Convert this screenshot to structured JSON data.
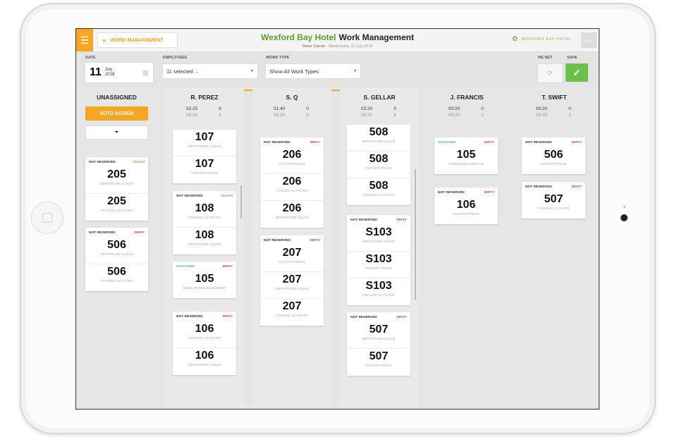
{
  "header": {
    "back_label": "WORK MANAGEMENT",
    "hotel": "Wexford Bay Hotel",
    "page": "Work Management",
    "user": "Steve Carran",
    "date_line": "Wednesday, 11 July 2018",
    "logo_text": "WEXFORD BAY HOTEL"
  },
  "toolbar": {
    "date_label": "DATE",
    "day": "11",
    "month": "July",
    "year": "2018",
    "employees_label": "EMPLOYEES",
    "employees_value": "11 selected ...",
    "worktype_label": "WORK TYPE",
    "worktype_value": "Show All Work Types",
    "reset_label": "RE-SET",
    "save_label": "SAVE"
  },
  "colors": {
    "accent": "#f5a623",
    "clean": "#6cc04a",
    "dirty": "#e0413c",
    "stayover": "#5aa7d8"
  },
  "columns": {
    "unassigned": {
      "title": "UNASSIGNED",
      "auto_assign": "AUTO ASSIGN",
      "cards": [
        {
          "status": "NOT RESERVED",
          "state": "CLEAN",
          "tasks": [
            {
              "room": "205",
              "type": "DEPARTURE CLEAN"
            },
            {
              "room": "205",
              "type": "CHANGE AC FILTER"
            }
          ]
        },
        {
          "status": "NOT RESERVED",
          "state": "DIRTY",
          "tasks": [
            {
              "room": "506",
              "type": "DEPARTURE CLEAN"
            },
            {
              "room": "506",
              "type": "CHANGE AC FILTER"
            }
          ]
        }
      ]
    },
    "perez": {
      "title": "R. PEREZ",
      "time_top": "02:25",
      "time_bot": "08:30",
      "count_top": "0",
      "count_bot": "8",
      "cards": [
        {
          "tasks": [
            {
              "room": "107",
              "type": "DEPARTURE CLEAN"
            },
            {
              "room": "107",
              "type": "FLIP MATTRESS"
            }
          ]
        },
        {
          "status": "NOT RESERVED",
          "state": "CLEAN",
          "tasks": [
            {
              "room": "108",
              "type": "CHANGE AC FILTER"
            },
            {
              "room": "108",
              "type": "DEPARTURE CLEAN"
            }
          ]
        },
        {
          "status": "STAYOVER",
          "state": "DIRTY",
          "tasks": [
            {
              "room": "105",
              "type": "MINIBAR REPLENISHMENT"
            }
          ]
        },
        {
          "status": "NOT RESERVED",
          "state": "DIRTY",
          "tasks": [
            {
              "room": "106",
              "type": "CHANGE AC FILTER"
            },
            {
              "room": "106",
              "type": "DEPARTURE CLEAN"
            }
          ]
        }
      ]
    },
    "sq": {
      "title": "S. Q",
      "time_top": "01:40",
      "time_bot": "08:30",
      "count_top": "0",
      "count_bot": "6",
      "cards": [
        {
          "status": "NOT RESERVED",
          "state": "DIRTY",
          "tasks": [
            {
              "room": "206",
              "type": "FLIP MATTRESS"
            },
            {
              "room": "206",
              "type": "CHANGE AC FILTER"
            },
            {
              "room": "206",
              "type": "DEPARTURE CLEAN"
            }
          ]
        },
        {
          "status": "NOT RESERVED",
          "state": "DIRTY",
          "tasks": [
            {
              "room": "207",
              "type": "FLIP MATTRESS"
            },
            {
              "room": "207",
              "type": "DEPARTURE CLEAN"
            },
            {
              "room": "207",
              "type": "CHANGE AC FILTER"
            }
          ]
        }
      ]
    },
    "gellar": {
      "title": "S. GELLAR",
      "time_top": "02:20",
      "time_bot": "08:30",
      "count_top": "0",
      "count_bot": "8",
      "cards": [
        {
          "tasks": [
            {
              "room": "508",
              "type": "DEPARTURE CLEAN"
            },
            {
              "room": "508",
              "type": "FLIP MATTRESS"
            },
            {
              "room": "508",
              "type": "CHANGE AC FILTER"
            }
          ]
        },
        {
          "status": "NOT RESERVED",
          "state": "DIRTY",
          "tasks": [
            {
              "room": "S103",
              "type": "DEPARTURE CLEAN"
            },
            {
              "room": "S103",
              "type": "FLIP MATTRESS"
            },
            {
              "room": "S103",
              "type": "CHANGE AC FILTER"
            }
          ]
        },
        {
          "status": "NOT RESERVED",
          "state": "DIRTY",
          "tasks": [
            {
              "room": "507",
              "type": "DEPARTURE CLEAN"
            },
            {
              "room": "507",
              "type": "FLIP MATTRESS"
            }
          ]
        }
      ]
    },
    "francis": {
      "title": "J. FRANCIS",
      "time_top": "00:20",
      "time_bot": "08:30",
      "count_top": "0",
      "count_bot": "2",
      "cards": [
        {
          "status": "STAYOVER",
          "state": "DIRTY",
          "tasks": [
            {
              "room": "105",
              "type": "TURNDOWN SERVICE"
            }
          ]
        },
        {
          "status": "NOT RESERVED",
          "state": "DIRTY",
          "tasks": [
            {
              "room": "106",
              "type": "FLIP MATTRESS"
            }
          ]
        }
      ]
    },
    "swift": {
      "title": "T. SWIFT",
      "time_top": "00:20",
      "time_bot": "08:30",
      "count_top": "0",
      "count_bot": "2",
      "cards": [
        {
          "status": "NOT RESERVED",
          "state": "DIRTY",
          "tasks": [
            {
              "room": "506",
              "type": "FLIP MATTRESS"
            }
          ]
        },
        {
          "status": "NOT RESERVED",
          "state": "DIRTY",
          "tasks": [
            {
              "room": "507",
              "type": "CHANGE AC FILTER"
            }
          ]
        }
      ]
    }
  }
}
